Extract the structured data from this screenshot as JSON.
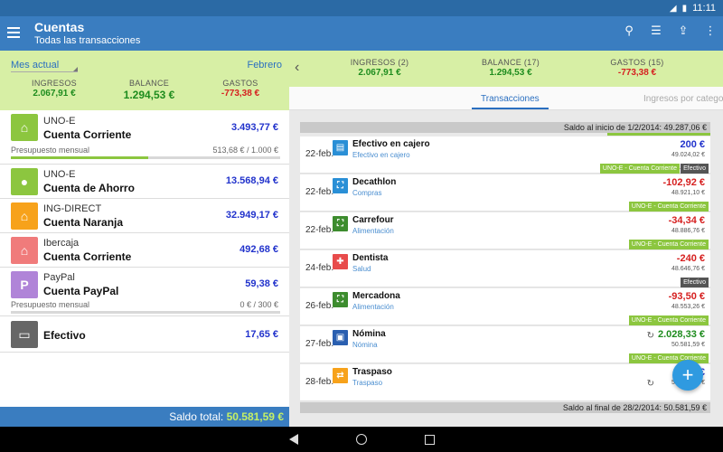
{
  "status": {
    "time": "11:11"
  },
  "appbar": {
    "title": "Cuentas",
    "subtitle": "Todas las transacciones"
  },
  "left_summary": {
    "period": "Mes actual",
    "month": "Febrero",
    "income_label": "INGRESOS",
    "income": "2.067,91 €",
    "balance_label": "BALANCE",
    "balance": "1.294,53 €",
    "expenses_label": "GASTOS",
    "expenses": "-773,38 €"
  },
  "accounts": [
    {
      "bank": "UNO-E",
      "name": "Cuenta Corriente",
      "balance": "3.493,77 €",
      "icon": "bank-icon",
      "color": "#8cc63f",
      "budget": {
        "label": "Presupuesto mensual",
        "value": "513,68 € / 1.000 €",
        "fraction": 0.51
      }
    },
    {
      "bank": "UNO-E",
      "name": "Cuenta de Ahorro",
      "balance": "13.568,94 €",
      "icon": "piggy-bank-icon",
      "color": "#8cc63f"
    },
    {
      "bank": "ING-DIRECT",
      "name": "Cuenta Naranja",
      "balance": "32.949,17 €",
      "icon": "bank-icon",
      "color": "#f7a21b"
    },
    {
      "bank": "Ibercaja",
      "name": "Cuenta Corriente",
      "balance": "492,68 €",
      "icon": "bank-icon",
      "color": "#f07b7b"
    },
    {
      "bank": "PayPal",
      "name": "Cuenta PayPal",
      "balance": "59,38 €",
      "icon": "paypal-icon",
      "color": "#b084d8",
      "budget": {
        "label": "Presupuesto mensual",
        "value": "0 € / 300 €",
        "fraction": 0
      }
    },
    {
      "bank": "",
      "name": "Efectivo",
      "balance": "17,65 €",
      "icon": "wallet-icon",
      "color": "#666666"
    }
  ],
  "total": {
    "label": "Saldo total:",
    "value": "50.581,59 €"
  },
  "right_summary": {
    "income_label": "INGRESOS (2)",
    "income": "2.067,91 €",
    "balance_label": "BALANCE (17)",
    "balance": "1.294,53 €",
    "expenses_label": "GASTOS (15)",
    "expenses": "-773,38 €"
  },
  "tabs": {
    "transactions": "Transacciones",
    "income_by_category": "Ingresos por categoría"
  },
  "saldo_start": "Saldo al inicio de 1/2/2014: 49.287,06 €",
  "saldo_end": "Saldo al final de 28/2/2014: 50.581,59 €",
  "transactions": [
    {
      "date": "22-feb.",
      "name": "Efectivo en cajero",
      "category": "Efectivo en cajero",
      "amount": "200 €",
      "running": "49.024,02 €",
      "icon": "atm-icon",
      "color": "#2a8fd6",
      "sign": "pos",
      "tags": [
        "UNO-E - Cuenta Corriente",
        "Efectivo"
      ],
      "recurring": false
    },
    {
      "date": "22-feb.",
      "name": "Decathlon",
      "category": "Compras",
      "amount": "-102,92 €",
      "running": "48.921,10 €",
      "icon": "basket-icon",
      "color": "#2a8fd6",
      "sign": "neg",
      "tags": [
        "UNO-E - Cuenta Corriente"
      ],
      "recurring": false
    },
    {
      "date": "22-feb.",
      "name": "Carrefour",
      "category": "Alimentación",
      "amount": "-34,34 €",
      "running": "48.886,76 €",
      "icon": "basket-icon",
      "color": "#3d8c2e",
      "sign": "neg",
      "tags": [
        "UNO-E - Cuenta Corriente"
      ],
      "recurring": false
    },
    {
      "date": "24-feb.",
      "name": "Dentista",
      "category": "Salud",
      "amount": "-240 €",
      "running": "48.646,76 €",
      "icon": "medical-cross-icon",
      "color": "#e84b4b",
      "sign": "neg",
      "tags": [
        "Efectivo"
      ],
      "recurring": false
    },
    {
      "date": "26-feb.",
      "name": "Mercadona",
      "category": "Alimentación",
      "amount": "-93,50 €",
      "running": "48.553,26 €",
      "icon": "basket-icon",
      "color": "#3d8c2e",
      "sign": "neg",
      "tags": [
        "UNO-E - Cuenta Corriente"
      ],
      "recurring": false
    },
    {
      "date": "27-feb.",
      "name": "Nómina",
      "category": "Nómina",
      "amount": "2.028,33 €",
      "running": "50.581,59 €",
      "icon": "payroll-icon",
      "color": "#2a5fb0",
      "sign": "inc",
      "tags": [
        "UNO-E - Cuenta Corriente"
      ],
      "recurring": true
    },
    {
      "date": "28-feb.",
      "name": "Traspaso",
      "category": "Traspaso",
      "amount": "500 €",
      "running": "50.581,59 €",
      "icon": "transfer-icon",
      "color": "#f7a21b",
      "sign": "pos",
      "tags": [],
      "recurring": true
    }
  ],
  "icons": {
    "add": "+"
  }
}
